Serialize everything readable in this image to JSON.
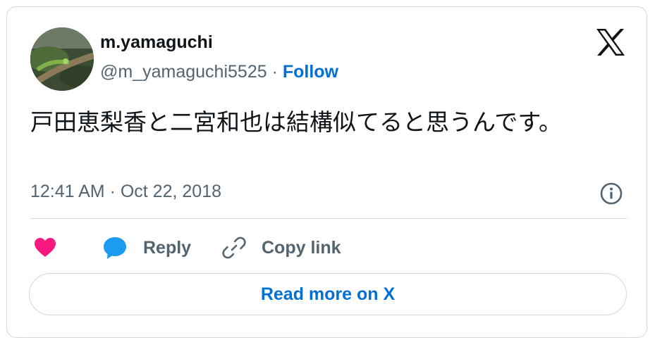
{
  "author": {
    "display_name": "m.yamaguchi",
    "handle": "@m_yamaguchi5525",
    "separator": " · ",
    "follow_label": "Follow"
  },
  "tweet": {
    "text": "戸田恵梨香と二宮和也は結構似てると思うんです。",
    "timestamp": "12:41 AM · Oct 22, 2018"
  },
  "actions": {
    "reply_label": "Reply",
    "copy_link_label": "Copy link"
  },
  "footer": {
    "read_more_label": "Read more on X"
  },
  "icons": {
    "brand": "x-logo-icon",
    "info": "info-icon",
    "like": "heart-icon",
    "reply": "reply-bubble-icon",
    "copy": "link-icon"
  },
  "colors": {
    "like": "#f91880",
    "reply": "#1d9bf0",
    "link": "#006fd6",
    "muted": "#536471",
    "text": "#0f1419",
    "border": "#cfd9de"
  }
}
